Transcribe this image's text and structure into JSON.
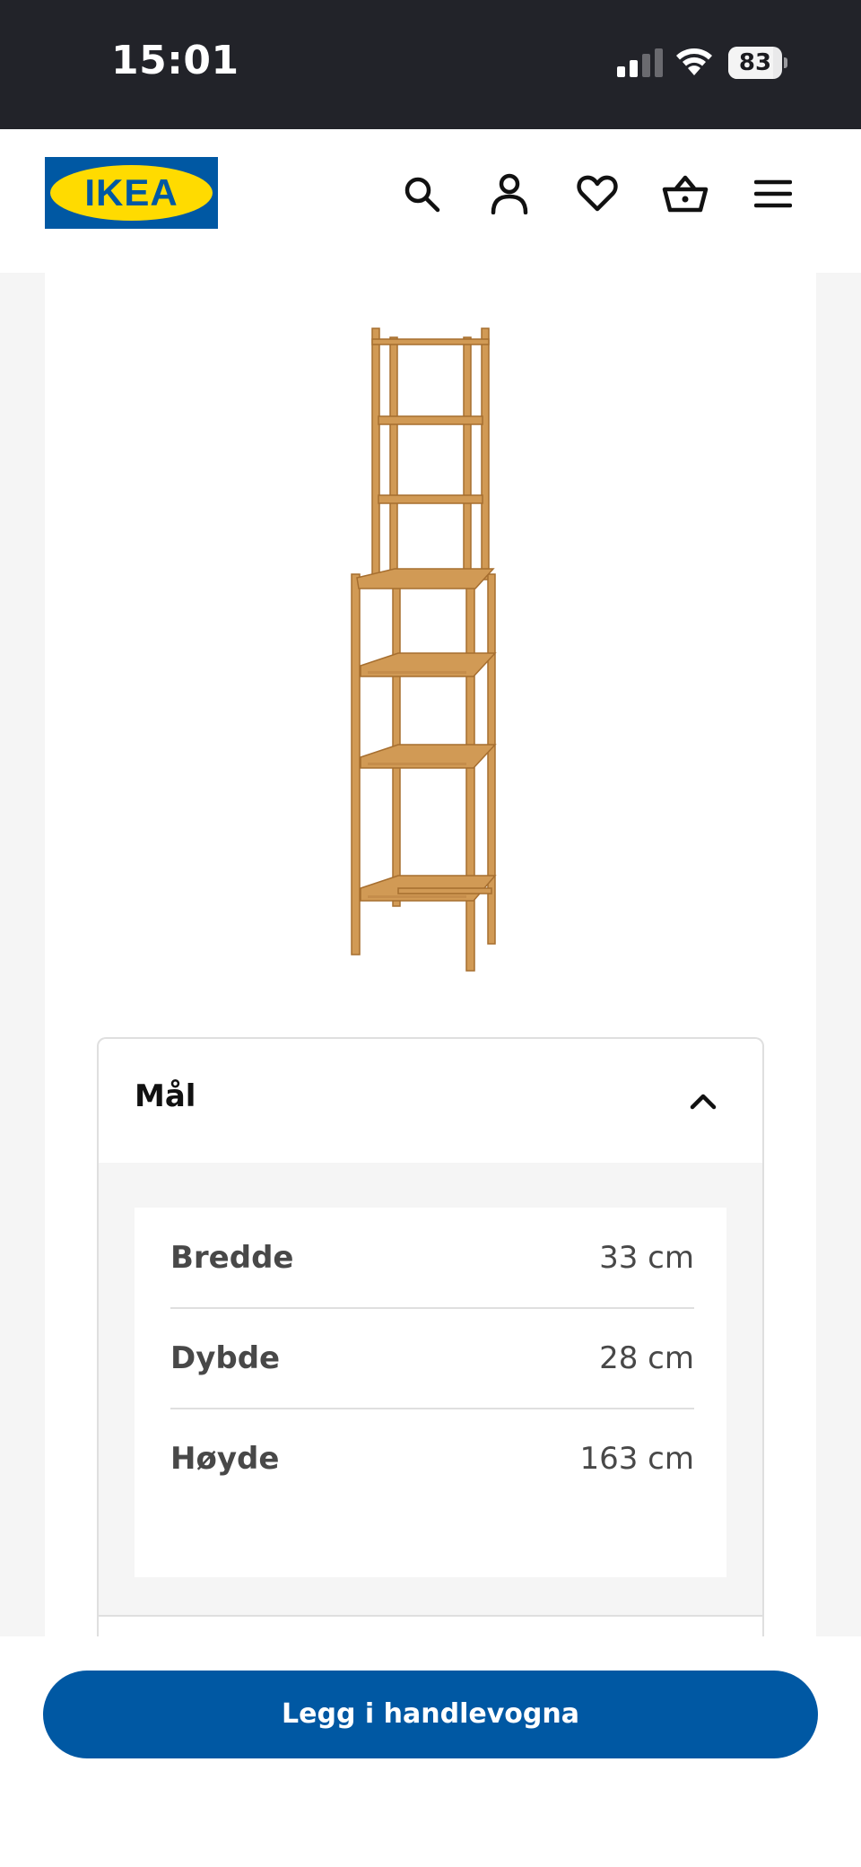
{
  "status_bar": {
    "time": "15:01",
    "battery_percent": "83",
    "battery_level": 0.83,
    "signal_bars_active": 2
  },
  "header": {
    "logo_text": "IKEA",
    "icons": [
      "search-icon",
      "profile-icon",
      "heart-icon",
      "basket-icon",
      "menu-icon"
    ],
    "brand_colors": {
      "blue": "#0058a3",
      "yellow": "#ffdb00"
    }
  },
  "product": {
    "image_icon": "bamboo-shelf-image"
  },
  "dimensions": {
    "title": "Mål",
    "expanded": true,
    "rows": [
      {
        "label": "Bredde",
        "value": "33 cm"
      },
      {
        "label": "Dybde",
        "value": "28 cm"
      },
      {
        "label": "Høyde",
        "value": "163 cm"
      }
    ]
  },
  "cta": {
    "label": "Legg i handlevogna",
    "color": "#0058a3"
  }
}
